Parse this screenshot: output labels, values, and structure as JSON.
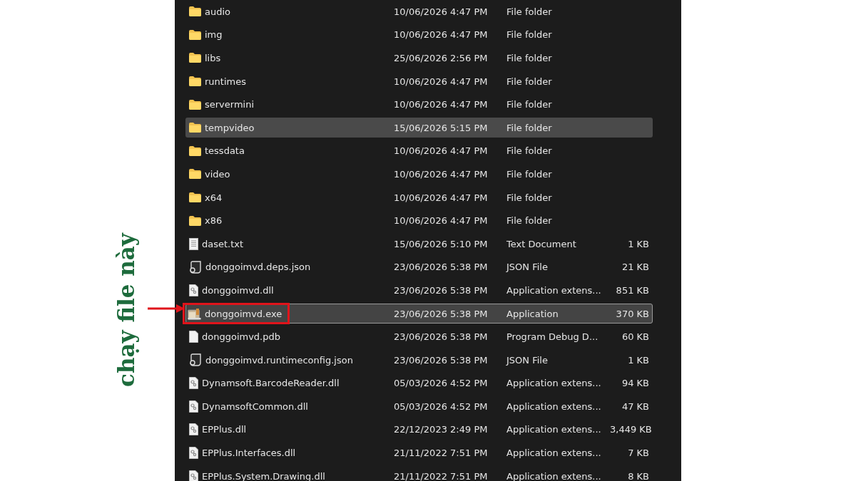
{
  "annotation": {
    "text": "chạy file này"
  },
  "files": [
    {
      "kind": "folder",
      "name": "audio",
      "date": "10/06/2026 4:47 PM",
      "type": "File folder",
      "hovered": false,
      "selected": false,
      "marked": false
    },
    {
      "kind": "folder",
      "name": "img",
      "date": "10/06/2026 4:47 PM",
      "type": "File folder",
      "hovered": false,
      "selected": false,
      "marked": false
    },
    {
      "kind": "folder",
      "name": "libs",
      "date": "25/06/2026 2:56 PM",
      "type": "File folder",
      "hovered": false,
      "selected": false,
      "marked": false
    },
    {
      "kind": "folder",
      "name": "runtimes",
      "date": "10/06/2026 4:47 PM",
      "type": "File folder",
      "hovered": false,
      "selected": false,
      "marked": false
    },
    {
      "kind": "folder",
      "name": "servermini",
      "date": "10/06/2026 4:47 PM",
      "type": "File folder",
      "hovered": false,
      "selected": false,
      "marked": false
    },
    {
      "kind": "folder",
      "name": "tempvideo",
      "date": "15/06/2026 5:15 PM",
      "type": "File folder",
      "hovered": true,
      "selected": false,
      "marked": false
    },
    {
      "kind": "folder",
      "name": "tessdata",
      "date": "10/06/2026 4:47 PM",
      "type": "File folder",
      "hovered": false,
      "selected": false,
      "marked": false
    },
    {
      "kind": "folder",
      "name": "video",
      "date": "10/06/2026 4:47 PM",
      "type": "File folder",
      "hovered": false,
      "selected": false,
      "marked": false
    },
    {
      "kind": "folder",
      "name": "x64",
      "date": "10/06/2026 4:47 PM",
      "type": "File folder",
      "hovered": false,
      "selected": false,
      "marked": false
    },
    {
      "kind": "folder",
      "name": "x86",
      "date": "10/06/2026 4:47 PM",
      "type": "File folder",
      "hovered": false,
      "selected": false,
      "marked": false
    },
    {
      "kind": "text",
      "name": "daset.txt",
      "date": "15/06/2026 5:10 PM",
      "type": "Text Document",
      "size": "1 KB",
      "hovered": false,
      "selected": false,
      "marked": false
    },
    {
      "kind": "json",
      "name": "donggoimvd.deps.json",
      "date": "23/06/2026 5:38 PM",
      "type": "JSON File",
      "size": "21 KB",
      "hovered": false,
      "selected": false,
      "marked": false
    },
    {
      "kind": "dll",
      "name": "donggoimvd.dll",
      "date": "23/06/2026 5:38 PM",
      "type": "Application extens...",
      "size": "851 KB",
      "hovered": false,
      "selected": false,
      "marked": false
    },
    {
      "kind": "exe",
      "name": "donggoimvd.exe",
      "date": "23/06/2026 5:38 PM",
      "type": "Application",
      "size": "370 KB",
      "hovered": false,
      "selected": true,
      "marked": true
    },
    {
      "kind": "blank",
      "name": "donggoimvd.pdb",
      "date": "23/06/2026 5:38 PM",
      "type": "Program Debug D...",
      "size": "60 KB",
      "hovered": false,
      "selected": false,
      "marked": false
    },
    {
      "kind": "json",
      "name": "donggoimvd.runtimeconfig.json",
      "date": "23/06/2026 5:38 PM",
      "type": "JSON File",
      "size": "1 KB",
      "hovered": false,
      "selected": false,
      "marked": false
    },
    {
      "kind": "dll",
      "name": "Dynamsoft.BarcodeReader.dll",
      "date": "05/03/2026 4:52 PM",
      "type": "Application extens...",
      "size": "94 KB",
      "hovered": false,
      "selected": false,
      "marked": false
    },
    {
      "kind": "dll",
      "name": "DynamsoftCommon.dll",
      "date": "05/03/2026 4:52 PM",
      "type": "Application extens...",
      "size": "47 KB",
      "hovered": false,
      "selected": false,
      "marked": false
    },
    {
      "kind": "dll",
      "name": "EPPlus.dll",
      "date": "22/12/2023 2:49 PM",
      "type": "Application extens...",
      "size": "3,449 KB",
      "hovered": false,
      "selected": false,
      "marked": false
    },
    {
      "kind": "dll",
      "name": "EPPlus.Interfaces.dll",
      "date": "21/11/2022 7:51 PM",
      "type": "Application extens...",
      "size": "7 KB",
      "hovered": false,
      "selected": false,
      "marked": false
    },
    {
      "kind": "dll",
      "name": "EPPlus.System.Drawing.dll",
      "date": "21/11/2022 7:51 PM",
      "type": "Application extens...",
      "size": "8 KB",
      "hovered": false,
      "selected": false,
      "marked": false
    }
  ]
}
